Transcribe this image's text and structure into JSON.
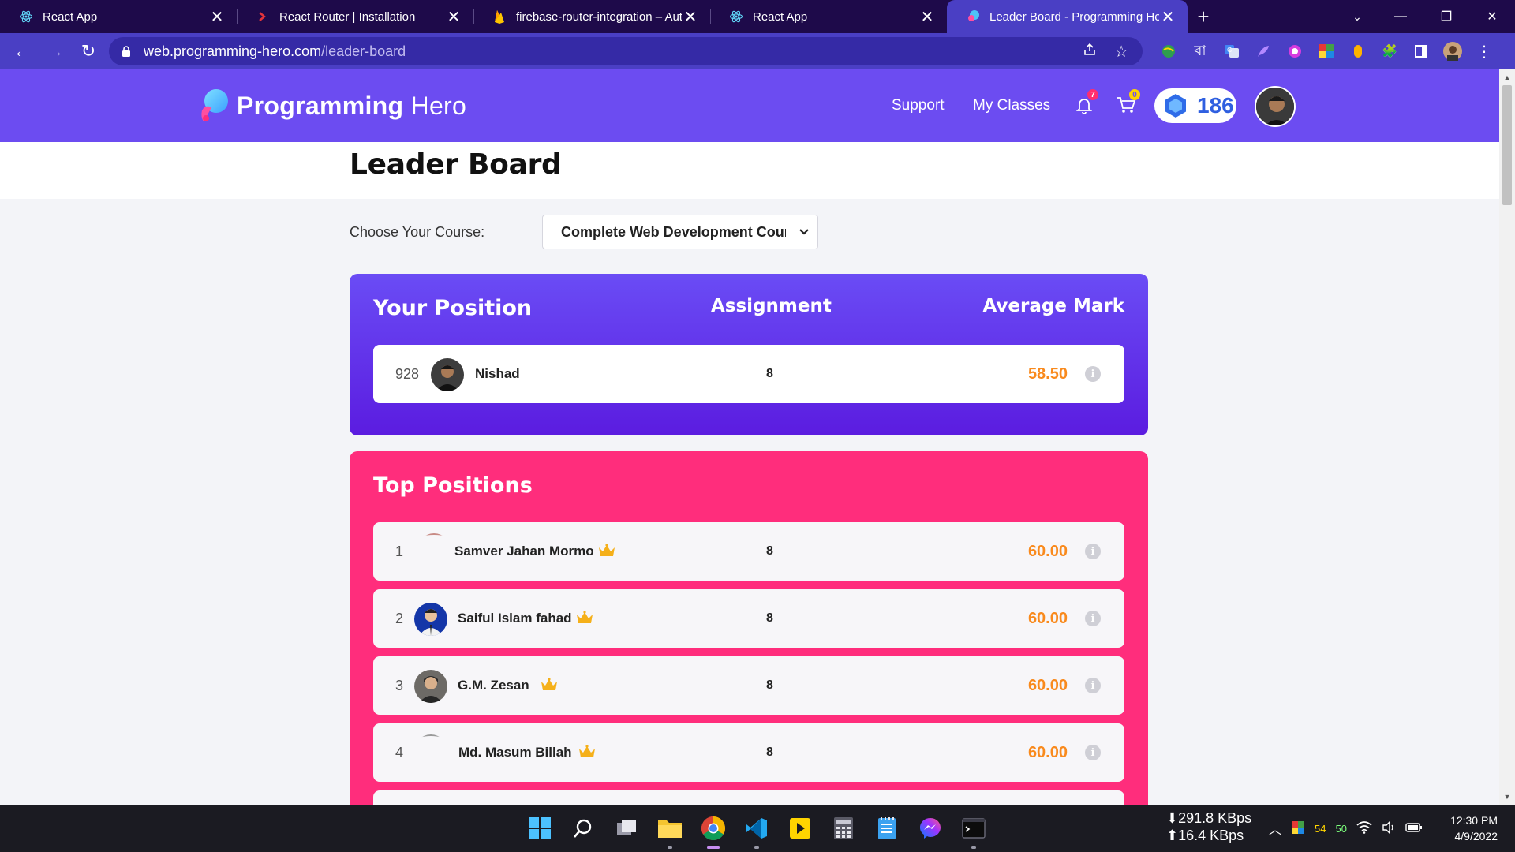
{
  "browser": {
    "tabs": [
      {
        "title": "React App",
        "icon": "react-icon",
        "active": false
      },
      {
        "title": "React Router | Installation",
        "icon": "react-router-icon",
        "active": false
      },
      {
        "title": "firebase-router-integration – Aut",
        "icon": "firebase-icon",
        "active": false
      },
      {
        "title": "React App",
        "icon": "react-icon",
        "active": false
      },
      {
        "title": "Leader Board - Programming He",
        "icon": "programming-hero-icon",
        "active": true
      }
    ],
    "url_host": "web.programming-hero.com",
    "url_path": "/leader-board"
  },
  "header": {
    "brand_bold": "Programming",
    "brand_light": "Hero",
    "nav": {
      "support": "Support",
      "classes": "My Classes"
    },
    "notification_count": "7",
    "cart_count": "0",
    "gems": "186"
  },
  "page": {
    "title": "Leader Board",
    "course_label": "Choose Your Course:",
    "course_selected": "Complete Web Development Course"
  },
  "your_position": {
    "heading": "Your Position",
    "col_assignment": "Assignment",
    "col_average": "Average Mark",
    "row": {
      "rank": "928",
      "name": "Nishad",
      "assignment": "8",
      "average": "58.50"
    }
  },
  "top_positions": {
    "heading": "Top Positions",
    "rows": [
      {
        "rank": "1",
        "name": "Samver Jahan Mormo",
        "assignment": "8",
        "average": "60.00"
      },
      {
        "rank": "2",
        "name": "Saiful Islam fahad",
        "assignment": "8",
        "average": "60.00"
      },
      {
        "rank": "3",
        "name": "G.M. Zesan",
        "assignment": "8",
        "average": "60.00"
      },
      {
        "rank": "4",
        "name": "Md. Masum Billah",
        "assignment": "8",
        "average": "60.00"
      }
    ]
  },
  "taskbar": {
    "down_speed": "⬇291.8 KBps",
    "up_speed": "⬆16.4 KBps",
    "tray_a": "54",
    "tray_b": "50",
    "time": "12:30 PM",
    "date": "4/9/2022"
  },
  "colors": {
    "header": "#6c4cf1",
    "your_position_card": "#5b1ce0",
    "top_positions_card": "#ff2d7c",
    "mark": "#f98a1d",
    "gems": "#2f5fe0"
  }
}
